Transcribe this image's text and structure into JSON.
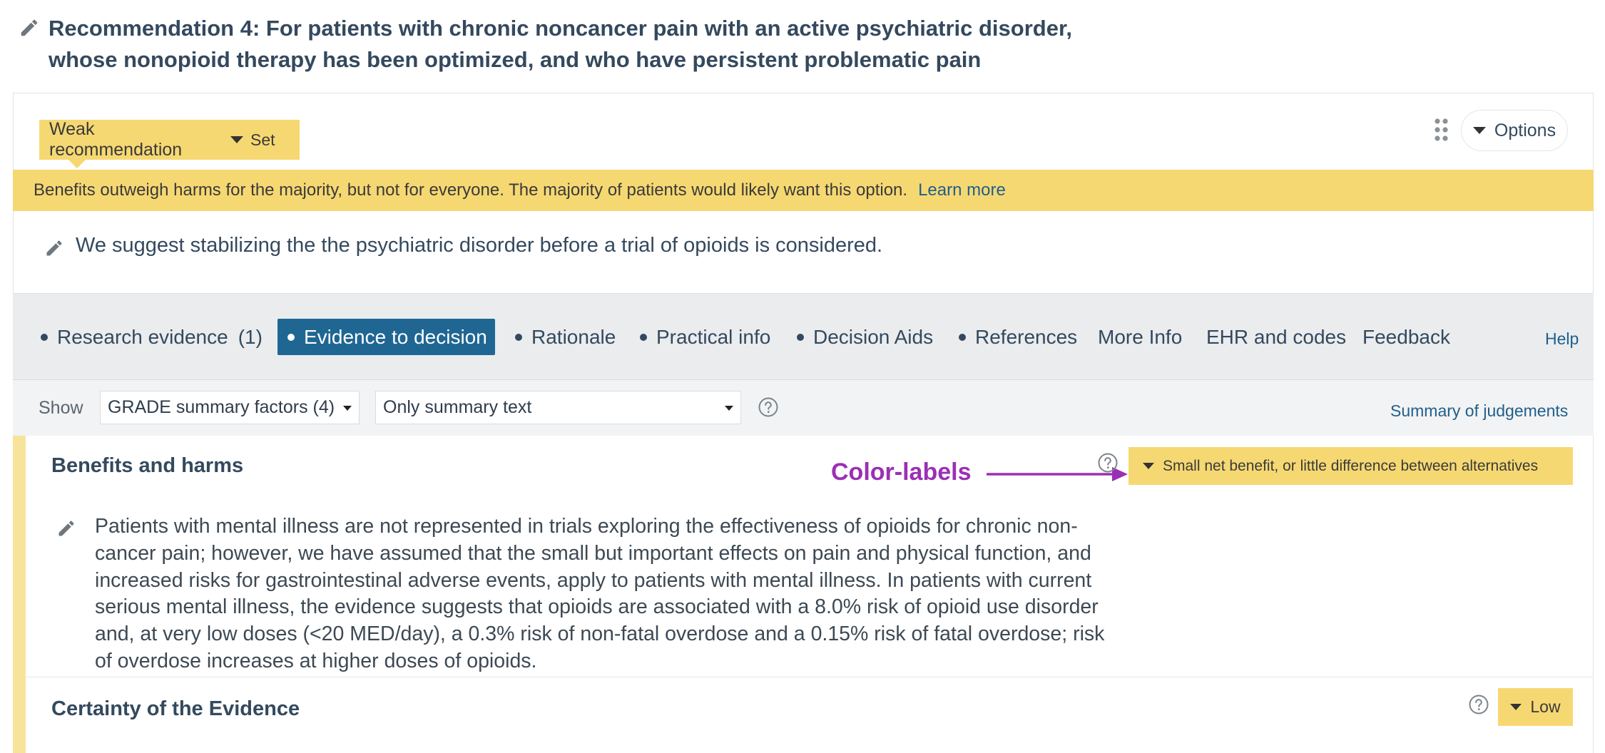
{
  "header": {
    "title": "Recommendation 4: For patients with chronic noncancer pain with an active psychiatric disorder, whose nonopioid therapy has been optimized, and who have persistent problematic pain",
    "edit_icon": "pencil-icon"
  },
  "strength": {
    "label": "Weak recommendation",
    "set_label": "Set",
    "color": "#f6d872"
  },
  "options_label": "Options",
  "banner": {
    "text": "Benefits outweigh harms for the majority, but not for everyone. The majority of patients would likely want this option.",
    "learn_more": "Learn more"
  },
  "recommendation_text": "We suggest stabilizing the the psychiatric disorder before a trial of opioids is considered.",
  "tabs": [
    {
      "label": "Research evidence",
      "count": "(1)"
    },
    {
      "label": "Evidence to decision",
      "active": true
    },
    {
      "label": "Rationale"
    },
    {
      "label": "Practical info"
    },
    {
      "label": "Decision Aids"
    },
    {
      "label": "References"
    },
    {
      "label": "More Info"
    },
    {
      "label": "EHR and codes"
    },
    {
      "label": "Feedback"
    }
  ],
  "help_label": "Help",
  "filter": {
    "show_label": "Show",
    "factors_select": "GRADE summary factors (4)",
    "text_select": "Only summary text",
    "summary_link": "Summary of judgements"
  },
  "sections": {
    "benefits": {
      "title": "Benefits and harms",
      "annotation": "Color-labels",
      "judgement": "Small net benefit, or little difference between alternatives",
      "text": "Patients with mental illness are not represented in trials exploring the effectiveness of opioids for chronic non-cancer pain; however, we have assumed that the small but important effects on pain and physical function, and increased risks for gastrointestinal adverse events, apply to patients with mental illness. In patients with current serious mental illness, the evidence suggests that opioids are associated with a 8.0% risk of opioid use disorder and, at very low doses (<20 MED/day), a 0.3% risk of non-fatal overdose and a 0.15% risk of fatal overdose; risk of overdose increases at higher doses of opioids."
    },
    "certainty": {
      "title": "Certainty of the Evidence",
      "judgement": "Low"
    }
  },
  "colors": {
    "accent_blue": "#1f6693",
    "link": "#1f5f8b",
    "annotation_purple": "#9b2fb5",
    "yellow": "#f6d872"
  }
}
